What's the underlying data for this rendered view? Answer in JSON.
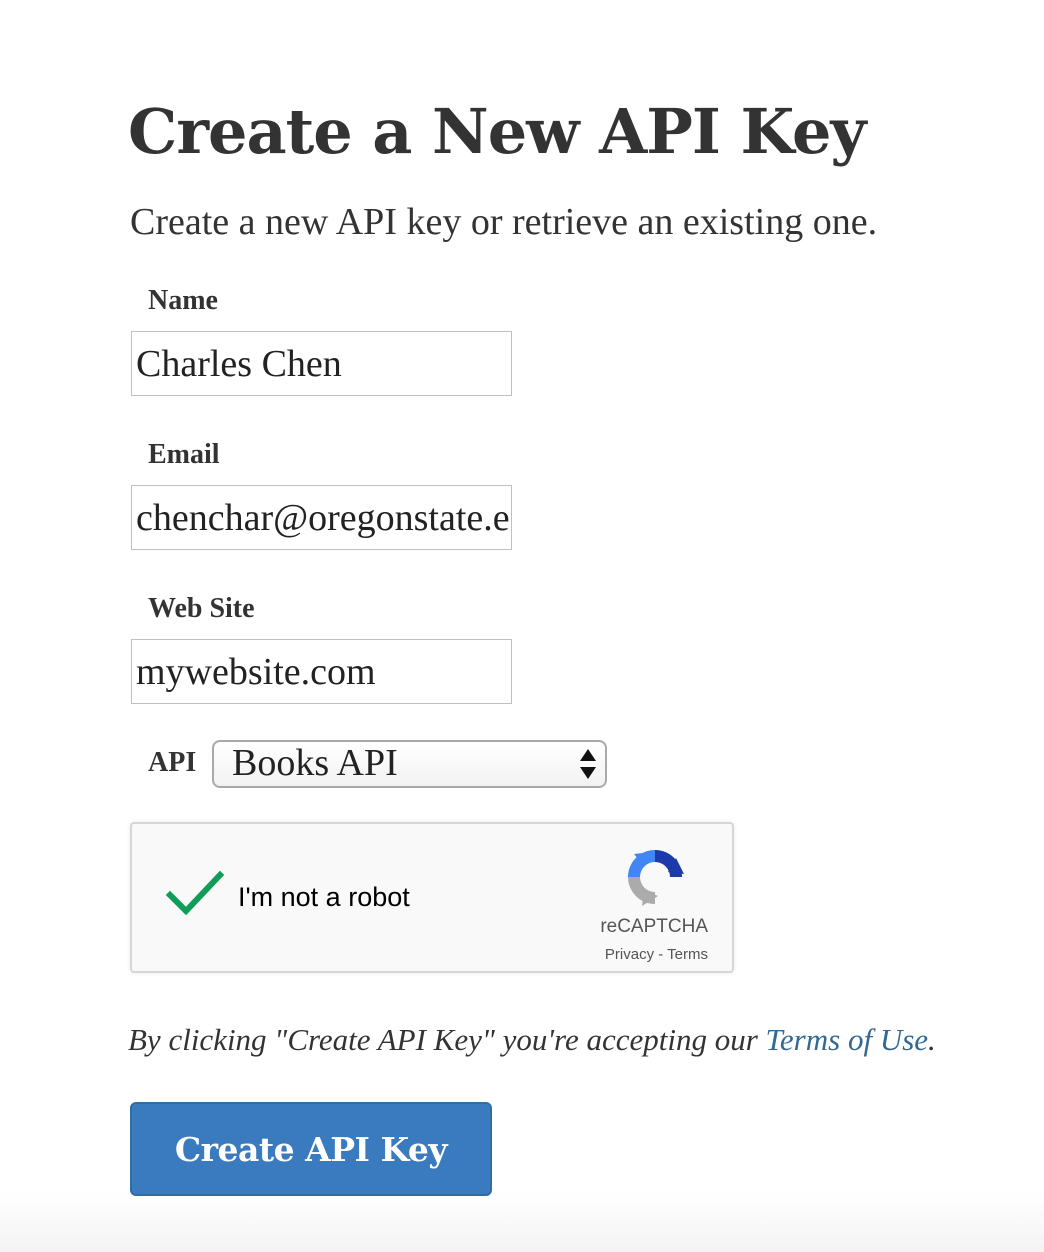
{
  "page": {
    "title": "Create a New API Key",
    "subtitle": "Create a new API key or retrieve an existing one."
  },
  "form": {
    "name": {
      "label": "Name",
      "value": "Charles Chen"
    },
    "email": {
      "label": "Email",
      "value": "chenchar@oregonstate.edu"
    },
    "website": {
      "label": "Web Site",
      "value": "mywebsite.com"
    },
    "api": {
      "label": "API",
      "selected": "Books API"
    }
  },
  "recaptcha": {
    "checked": true,
    "label": "I'm not a robot",
    "brand": "reCAPTCHA",
    "privacy": "Privacy",
    "separator": " - ",
    "terms": "Terms",
    "check_color": "#0f9d58"
  },
  "terms_note": {
    "prefix": "By clicking \"Create API Key\" you're accepting our ",
    "link": "Terms of Use",
    "suffix": "."
  },
  "submit": {
    "label": "Create API Key"
  },
  "colors": {
    "text": "#333333",
    "link": "#326891",
    "button": "#3a7bbf"
  }
}
